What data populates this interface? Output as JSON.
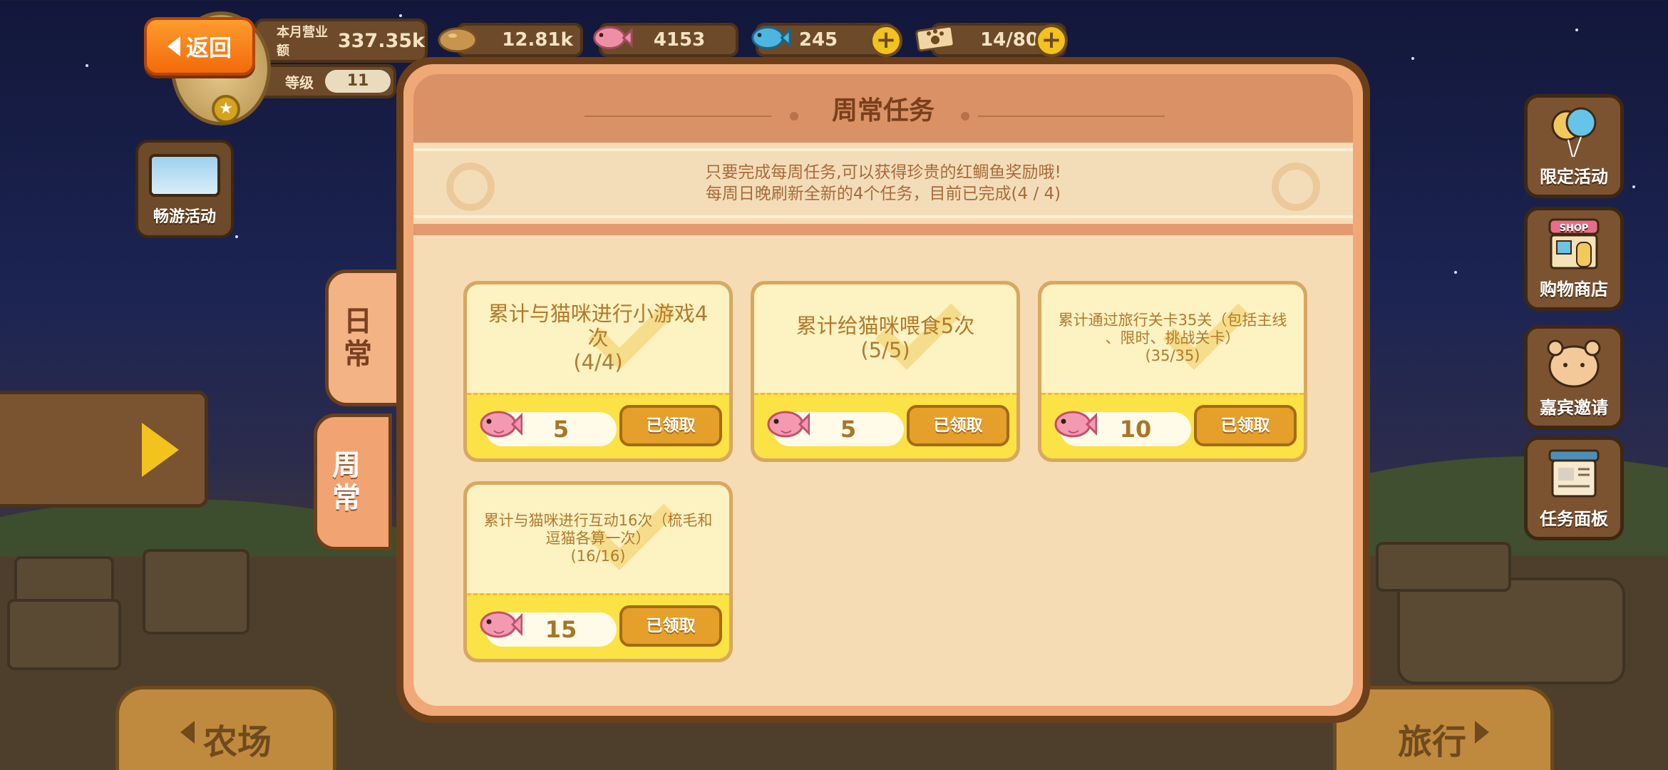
{
  "header": {
    "back_label": "返回",
    "revenue_label": "本月营业额",
    "revenue_value": "337.35k",
    "level_label": "等级",
    "level_value": "11"
  },
  "resources": [
    {
      "icon": "bread-icon",
      "value": "12.81k"
    },
    {
      "icon": "red-snapper-icon",
      "value": "4153"
    },
    {
      "icon": "blue-fish-icon",
      "value": "245"
    },
    {
      "icon": "paw-ticket-icon",
      "value": "14/80"
    }
  ],
  "left": {
    "tour_label": "畅游活动"
  },
  "tabs": {
    "daily": "日常",
    "weekly": "周常"
  },
  "bottom": {
    "farm_label": "农场",
    "travel_label": "旅行"
  },
  "right_menu": [
    {
      "icon": "balloon-icon",
      "label": "限定活动"
    },
    {
      "icon": "shop-icon",
      "label": "购物商店"
    },
    {
      "icon": "hamster-icon",
      "label": "嘉宾邀请"
    },
    {
      "icon": "task-board-icon",
      "label": "任务面板"
    }
  ],
  "dialog": {
    "title": "周常任务",
    "desc_line1": "只要完成每周任务,可以获得珍贵的红鲷鱼奖励哦!",
    "desc_line2": "每周日晚刷新全新的4个任务，目前已完成(4 / 4)"
  },
  "tasks": [
    {
      "line1": "累计与猫咪进行小游戏4次",
      "line2": "",
      "progress": "(4/4)",
      "reward": "5",
      "button": "已领取",
      "status": "claimed"
    },
    {
      "line1": "累计给猫咪喂食5次",
      "line2": "",
      "progress": "(5/5)",
      "reward": "5",
      "button": "已领取",
      "status": "claimed"
    },
    {
      "line1": "累计通过旅行关卡35关（包括主线",
      "line2": "、限时、挑战关卡）",
      "progress": "(35/35)",
      "reward": "10",
      "button": "已领取",
      "status": "claimed"
    },
    {
      "line1": "累计与猫咪进行互动16次（梳毛和",
      "line2": "逗猫各算一次）",
      "progress": "(16/16)",
      "reward": "15",
      "button": "已领取",
      "status": "claimed"
    }
  ],
  "colors": {
    "accent_orange": "#f36a0a",
    "gold": "#e4a02a",
    "dialog_border": "#6b3f1a",
    "sky": "#1c2452"
  }
}
